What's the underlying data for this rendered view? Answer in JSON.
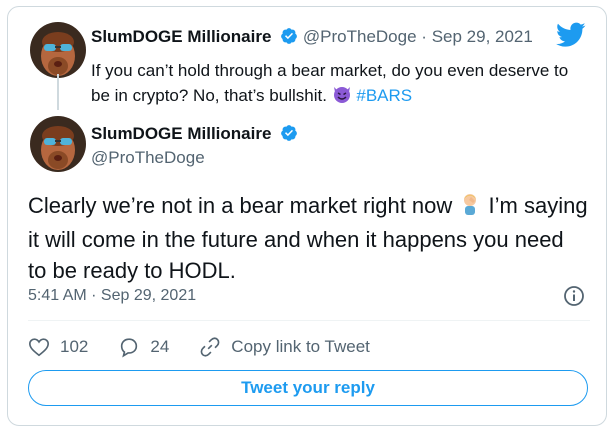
{
  "quoted_tweet": {
    "author_name": "SlumDOGE Millionaire",
    "handle": "@ProTheDoge",
    "date": "Sep 29, 2021",
    "text_before_emoji": "If you can’t hold through a bear market, do you even deserve to be in crypto? No, that’s bullshit. ",
    "emoji_icon": "smiling-devil-emoji",
    "hashtag": "#BARS"
  },
  "main_tweet": {
    "author_name": "SlumDOGE Millionaire",
    "handle": "@ProTheDoge",
    "text_before_emoji": "Clearly we’re not in a bear market right now ",
    "emoji_icon": "person-facepalming-emoji",
    "text_after_emoji": " I’m saying it will come in the future and when it happens you need to be ready to HODL.",
    "timestamp": "5:41 AM · Sep 29, 2021"
  },
  "actions": {
    "likes": "102",
    "replies": "24",
    "copy_link_label": "Copy link to Tweet"
  },
  "reply_button_label": "Tweet your reply",
  "colors": {
    "accent": "#1d9bf0",
    "muted": "#536471",
    "border": "#cfd9de",
    "devil_purple": "#8b5ad6"
  }
}
